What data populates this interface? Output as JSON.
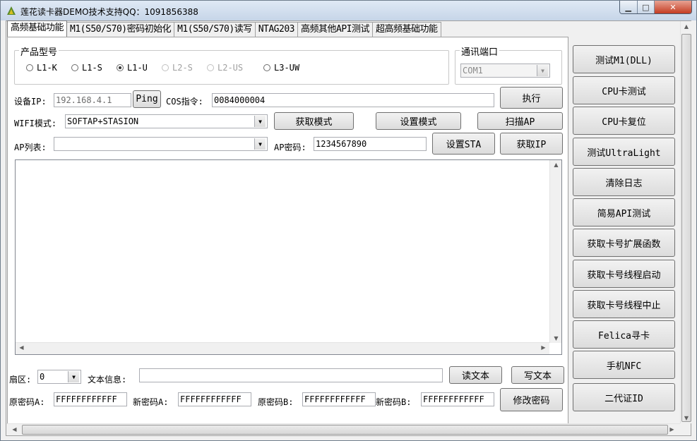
{
  "window": {
    "title": "莲花读卡器DEMO技术支持QQ：1091856388"
  },
  "tabs": [
    "高频基础功能",
    "M1(S50/S70)密码初始化",
    "M1(S50/S70)读写",
    "NTAG203",
    "高频其他API测试",
    "超高频基础功能"
  ],
  "product": {
    "group_label": "产品型号",
    "options": [
      {
        "label": "L1-K",
        "checked": false,
        "enabled": true
      },
      {
        "label": "L1-S",
        "checked": false,
        "enabled": true
      },
      {
        "label": "L1-U",
        "checked": true,
        "enabled": true
      },
      {
        "label": "L2-S",
        "checked": false,
        "enabled": false
      },
      {
        "label": "L2-US",
        "checked": false,
        "enabled": false
      },
      {
        "label": "L3-UW",
        "checked": false,
        "enabled": true
      }
    ]
  },
  "port": {
    "group_label": "通讯端口",
    "value": "COM1"
  },
  "device": {
    "ip_label": "设备IP:",
    "ip_value": "192.168.4.1",
    "ping_label": "Ping",
    "cos_label": "COS指令:",
    "cos_value": "0084000004",
    "exec_label": "执行"
  },
  "wifi": {
    "mode_label": "WIFI模式:",
    "mode_value": "SOFTAP+STASION",
    "get_mode": "获取模式",
    "set_mode": "设置模式",
    "scan_ap": "扫描AP"
  },
  "ap": {
    "list_label": "AP列表:",
    "list_value": "",
    "pwd_label": "AP密码:",
    "pwd_value": "1234567890",
    "set_sta": "设置STA",
    "get_ip": "获取IP"
  },
  "log": {
    "content": ""
  },
  "sector": {
    "label": "扇区:",
    "value": "0",
    "text_label": "文本信息:",
    "text_value": "",
    "read_text": "读文本",
    "write_text": "写文本"
  },
  "keys": {
    "old_a_label": "原密码A:",
    "old_a": "FFFFFFFFFFFF",
    "new_a_label": "新密码A:",
    "new_a": "FFFFFFFFFFFF",
    "old_b_label": "原密码B:",
    "old_b": "FFFFFFFFFFFF",
    "new_b_label": "新密码B:",
    "new_b": "FFFFFFFFFFFF",
    "modify": "修改密码"
  },
  "side_buttons": [
    "测试M1(DLL)",
    "CPU卡测试",
    "CPU卡复位",
    "测试UltraLight",
    "清除日志",
    "简易API测试",
    "获取卡号扩展函数",
    "获取卡号线程启动",
    "获取卡号线程中止",
    "Felica寻卡",
    "手机NFC",
    "二代证ID"
  ]
}
